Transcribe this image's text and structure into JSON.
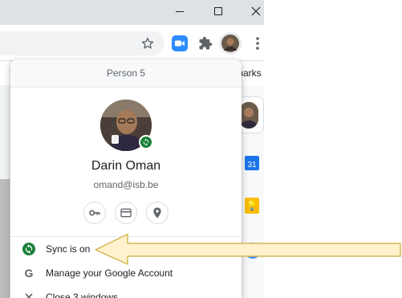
{
  "window": {
    "minimize_icon": "minimize-icon",
    "maximize_icon": "maximize-icon",
    "close_icon": "close-icon"
  },
  "toolbar": {
    "bookmark_star_icon": "star-icon",
    "zoom_extension_icon": "video-camera-icon",
    "extensions_icon": "puzzle-piece-icon",
    "profile_icon": "avatar",
    "menu_icon": "three-dots-vertical-icon"
  },
  "bookmarks_bar": {
    "partial_text": "marks"
  },
  "profile_menu": {
    "header": "Person 5",
    "name": "Darin Oman",
    "email": "omand@isb.be",
    "quick_actions": [
      {
        "name": "passwords",
        "icon": "key-icon"
      },
      {
        "name": "payment-methods",
        "icon": "credit-card-icon"
      },
      {
        "name": "addresses",
        "icon": "location-pin-icon"
      }
    ],
    "items": [
      {
        "label": "Sync is on",
        "icon": "sync-icon"
      },
      {
        "label": "Manage your Google Account",
        "icon": "google-g-icon"
      },
      {
        "label": "Close 3 windows",
        "icon": "close-icon"
      }
    ]
  },
  "colors": {
    "accent_green": "#188038",
    "annotation_arrow_fill": "#fff2cc",
    "annotation_arrow_stroke": "#d6b656",
    "google_blue": "#1a73e8"
  }
}
